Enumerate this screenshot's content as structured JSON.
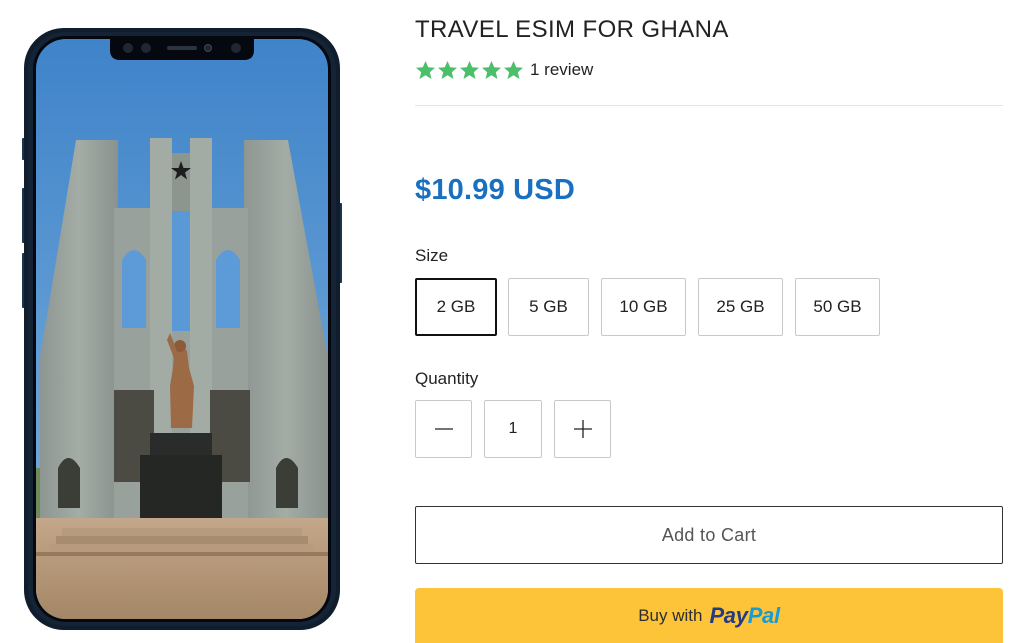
{
  "product": {
    "title": "TRAVEL ESIM FOR GHANA",
    "rating_stars": 5,
    "rating_max": 5,
    "review_text": "1 review",
    "price": "$10.99 USD"
  },
  "size": {
    "label": "Size",
    "options": [
      "2 GB",
      "5 GB",
      "10 GB",
      "25 GB",
      "50 GB"
    ],
    "selected": "2 GB"
  },
  "quantity": {
    "label": "Quantity",
    "value": "1"
  },
  "buttons": {
    "add_to_cart": "Add to Cart",
    "paypal_prefix": "Buy with",
    "paypal_logo_pay": "Pay",
    "paypal_logo_pal": "Pal"
  },
  "icons": {
    "star": "star-icon",
    "minus": "minus-icon",
    "plus": "plus-icon"
  },
  "colors": {
    "star": "#4cbf6a",
    "price": "#1a70c0",
    "paypal_bg": "#fdc439",
    "paypal_dark_blue": "#253b80",
    "paypal_light_blue": "#179bd7",
    "sky": "#4e8fd0",
    "phone_frame": "#0f1d2c"
  }
}
